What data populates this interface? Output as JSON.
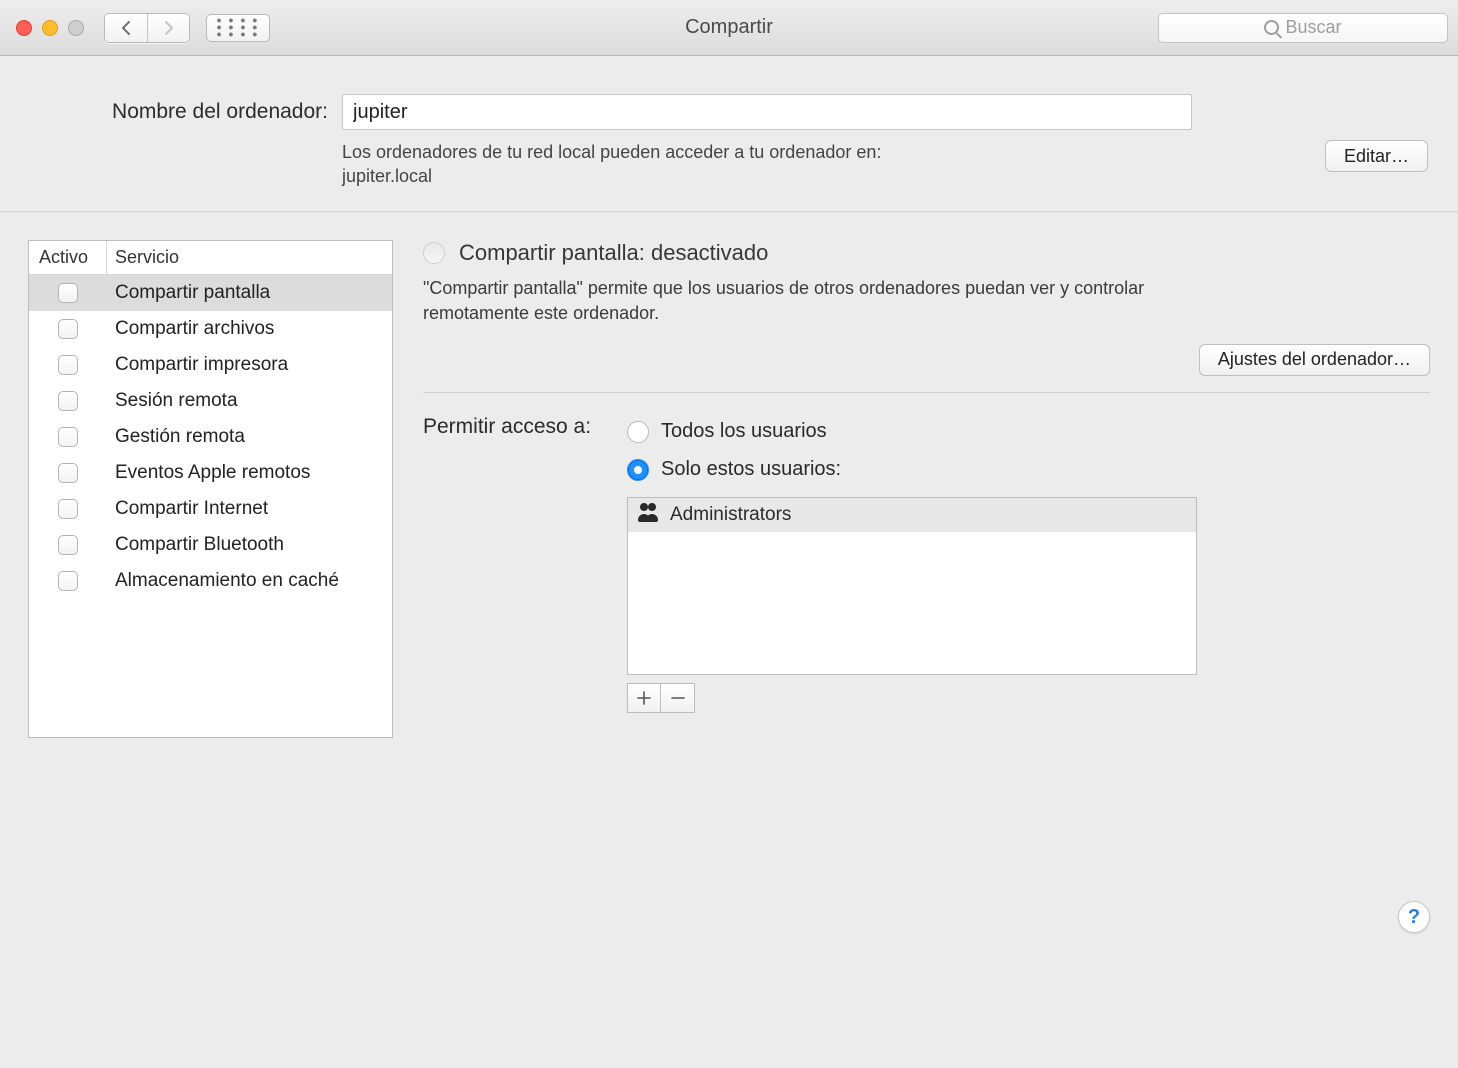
{
  "window": {
    "title": "Compartir",
    "search_placeholder": "Buscar"
  },
  "top": {
    "computer_name_label": "Nombre del ordenador:",
    "computer_name_value": "jupiter",
    "hostname_line1": "Los ordenadores de tu red local pueden acceder a tu ordenador en:",
    "hostname_line2": "jupiter.local",
    "edit_button": "Editar…"
  },
  "services": {
    "header_active": "Activo",
    "header_service": "Servicio",
    "items": [
      {
        "name": "Compartir pantalla",
        "on": false,
        "selected": true
      },
      {
        "name": "Compartir archivos",
        "on": false,
        "selected": false
      },
      {
        "name": "Compartir impresora",
        "on": false,
        "selected": false
      },
      {
        "name": "Sesión remota",
        "on": false,
        "selected": false
      },
      {
        "name": "Gestión remota",
        "on": false,
        "selected": false
      },
      {
        "name": "Eventos Apple remotos",
        "on": false,
        "selected": false
      },
      {
        "name": "Compartir Internet",
        "on": false,
        "selected": false
      },
      {
        "name": "Compartir Bluetooth",
        "on": false,
        "selected": false
      },
      {
        "name": "Almacenamiento en caché",
        "on": false,
        "selected": false
      }
    ]
  },
  "detail": {
    "status_title": "Compartir pantalla: desactivado",
    "status_desc": "\"Compartir pantalla\" permite que los usuarios de otros ordenadores puedan ver y controlar remotamente este ordenador.",
    "computer_settings_button": "Ajustes del ordenador…",
    "access_label": "Permitir acceso a:",
    "option_all_users": "Todos los usuarios",
    "option_only_these": "Solo estos usuarios:",
    "selected_option": "only_these",
    "users": [
      {
        "name": "Administrators",
        "type": "group"
      }
    ]
  },
  "help_glyph": "?"
}
